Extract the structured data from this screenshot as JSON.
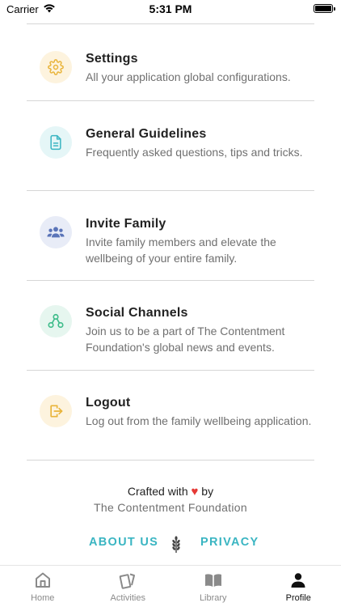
{
  "status_bar": {
    "carrier": "Carrier",
    "time": "5:31 PM"
  },
  "menu": [
    {
      "id": "settings",
      "title": "Settings",
      "description": "All your application global configurations.",
      "icon": "gear-icon",
      "icon_color": "#e9b43a"
    },
    {
      "id": "guidelines",
      "title": "General Guidelines",
      "description": "Frequently asked questions, tips and tricks.",
      "icon": "document-icon",
      "icon_color": "#3ab5c2"
    },
    {
      "id": "invite",
      "title": "Invite Family",
      "description": "Invite family members and elevate the wellbeing of your entire family.",
      "icon": "group-icon",
      "icon_color": "#5a74b8"
    },
    {
      "id": "social",
      "title": "Social Channels",
      "description": "Join us to be a part of The Contentment Foundation's global news and events.",
      "icon": "share-icon",
      "icon_color": "#3ebc8a"
    },
    {
      "id": "logout",
      "title": "Logout",
      "description": "Log out from the family wellbeing application.",
      "icon": "logout-icon",
      "icon_color": "#e9b43a"
    }
  ],
  "footer": {
    "crafted_prefix": "Crafted with",
    "crafted_suffix": "by",
    "heart": "♥",
    "foundation": "The Contentment Foundation",
    "about_label": "ABOUT US",
    "privacy_label": "PRIVACY",
    "link_color": "#3ab5c2"
  },
  "tabs": [
    {
      "label": "Home",
      "icon": "home-icon",
      "active": false
    },
    {
      "label": "Activities",
      "icon": "cards-icon",
      "active": false
    },
    {
      "label": "Library",
      "icon": "book-icon",
      "active": false
    },
    {
      "label": "Profile",
      "icon": "person-icon",
      "active": true
    }
  ]
}
